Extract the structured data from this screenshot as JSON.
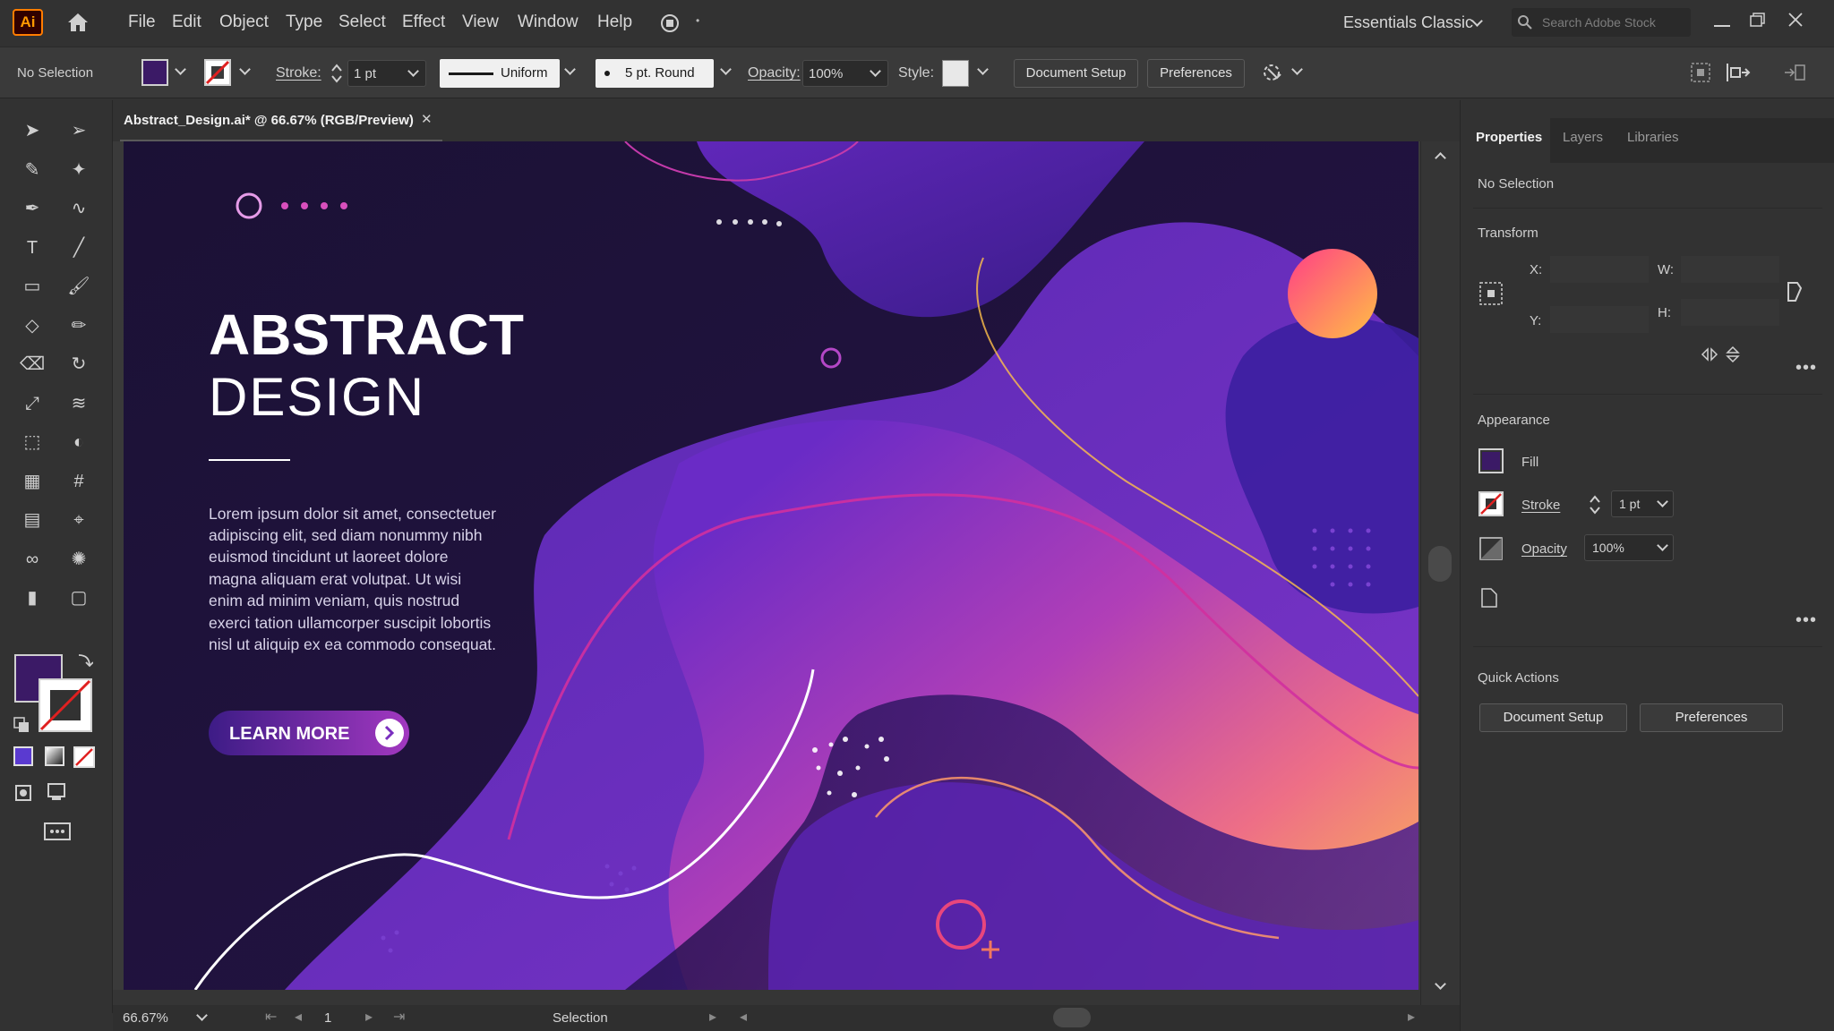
{
  "app": {
    "logo": "Ai",
    "menus": [
      "File",
      "Edit",
      "Object",
      "Type",
      "Select",
      "Effect",
      "View",
      "Window",
      "Help"
    ],
    "workspace": "Essentials Classic",
    "search_placeholder": "Search Adobe Stock"
  },
  "control_bar": {
    "selection": "No Selection",
    "fill_color": "#3b1a66",
    "stroke_label": "Stroke:",
    "stroke_value": "1 pt",
    "profile": "Uniform",
    "brush": "5 pt. Round",
    "opacity_label": "Opacity:",
    "opacity_value": "100%",
    "style_label": "Style:",
    "document_setup": "Document Setup",
    "preferences": "Preferences"
  },
  "document_tab": {
    "title": "Abstract_Design.ai* @ 66.67% (RGB/Preview)",
    "close": "✕"
  },
  "artwork": {
    "heading_bold": "ABSTRACT",
    "heading_light": "DESIGN",
    "body": "Lorem ipsum dolor sit amet, consectetuer adipiscing elit, sed diam nonummy nibh euismod tincidunt ut laoreet dolore magna aliquam erat volutpat. Ut wisi enim ad minim veniam, quis nostrud exerci tation ullamcorper suscipit lobortis nisl ut aliquip ex ea commodo consequat.",
    "body_lines": [
      "Lorem ipsum dolor sit amet, consectetuer",
      "adipiscing elit, sed diam nonummy nibh",
      "euismod tincidunt ut laoreet dolore",
      "magna aliquam erat volutpat. Ut wisi",
      "enim ad minim veniam, quis nostrud",
      "exerci tation ullamcorper suscipit lobortis",
      "nisl ut aliquip ex ea commodo consequat."
    ],
    "cta": "LEARN MORE",
    "colors": {
      "background": "#1c1238",
      "purple": "#6a2bc4",
      "magenta": "#c73bb0",
      "orange": "#f29a5e",
      "pink_circle": "#e8467c"
    }
  },
  "status_bar": {
    "zoom": "66.67%",
    "page": "1",
    "tool": "Selection"
  },
  "panel": {
    "tabs": [
      "Properties",
      "Layers",
      "Libraries"
    ],
    "active_tab": "Properties",
    "selection": "No Selection",
    "transform": {
      "title": "Transform",
      "x": "X:",
      "y": "Y:",
      "w": "W:",
      "h": "H:"
    },
    "appearance": {
      "title": "Appearance",
      "fill": "Fill",
      "stroke": "Stroke",
      "stroke_value": "1 pt",
      "opacity": "Opacity",
      "opacity_value": "100%"
    },
    "quick_actions": {
      "title": "Quick Actions",
      "document_setup": "Document Setup",
      "preferences": "Preferences"
    }
  },
  "tools": [
    "selection-tool",
    "direct-selection-tool",
    "magic-wand-tool",
    "lasso-tool",
    "pen-tool",
    "curvature-tool",
    "type-tool",
    "line-tool",
    "rectangle-tool",
    "paintbrush-tool",
    "shaper-tool",
    "pencil-tool",
    "eraser-tool",
    "rotate-tool",
    "scale-tool",
    "width-tool",
    "free-transform-tool",
    "shape-builder-tool",
    "perspective-grid-tool",
    "mesh-tool",
    "gradient-tool",
    "eyedropper-tool",
    "blend-tool",
    "symbol-sprayer-tool",
    "column-graph-tool",
    "artboard-tool",
    "slice-tool",
    "hand-tool",
    "zoom-tool"
  ]
}
